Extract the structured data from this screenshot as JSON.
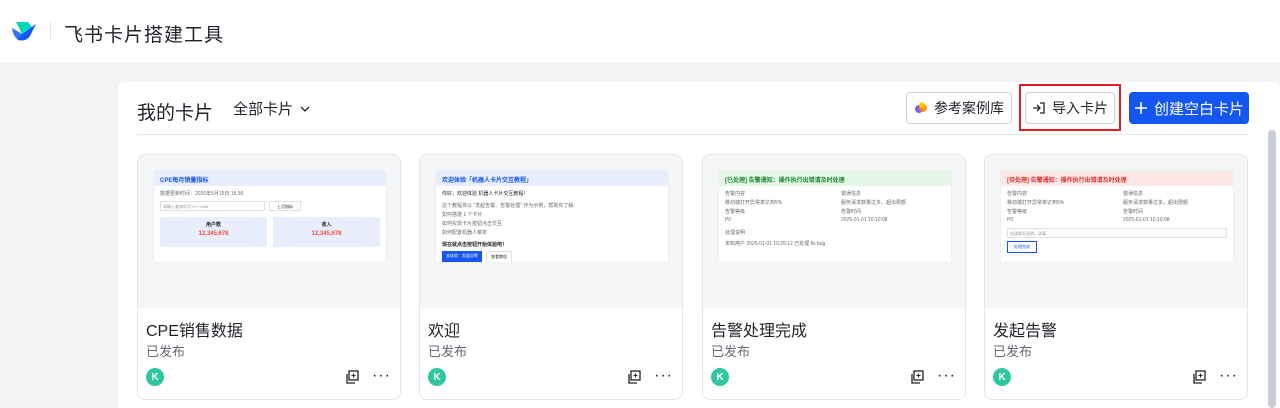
{
  "app": {
    "title": "飞书卡片搭建工具"
  },
  "panel": {
    "title": "我的卡片",
    "filter_label": "全部卡片",
    "buttons": {
      "library": "参考案例库",
      "import": "导入卡片",
      "create": "创建空白卡片"
    }
  },
  "cards": [
    {
      "name": "CPE销售数据",
      "status": "已发布",
      "owner_initial": "K",
      "preview": {
        "header": "CPE每月销量指标",
        "update": "数据更新时间：2020年5月15日 16:36",
        "input_placeholder": "请输入查询年月YYYYMM",
        "button": "上月指标",
        "metrics": [
          {
            "label": "用户数",
            "value": "12,345,678"
          },
          {
            "label": "收入",
            "value": "12,345,678"
          }
        ]
      }
    },
    {
      "name": "欢迎",
      "status": "已发布",
      "owner_initial": "K",
      "preview": {
        "header": "欢迎体验「机器人卡片交互教程」",
        "greeting": "你好，欢迎体验 机器人卡片交互教程！",
        "intro": "这个教程将以 \"发起告警、告警处理\" 作为示例，帮助你了解：",
        "bullets": [
          "如何搭建 1 个卡片",
          "如何实现卡片按钮点击交互",
          "如何配置机器人菜单"
        ],
        "cta_text": "现在就点击按钮开始体验吧！",
        "primary_button": "去体验：发起告警",
        "secondary_button": "查看教程"
      }
    },
    {
      "name": "告警处理完成",
      "status": "已发布",
      "owner_initial": "K",
      "preview": {
        "header": "[已处理] 告警通知：操作执行出错请及时处理",
        "fields": [
          {
            "label": "告警内容",
            "value": "移动端打开异常率达到5%"
          },
          {
            "label": "错误信息",
            "value": "服务请求数量过多，超出限额"
          },
          {
            "label": "告警等级",
            "value": "P0"
          },
          {
            "label": "告警时间",
            "value": "2025-01-01 10:10:08"
          }
        ],
        "section_label": "处理说明",
        "log": "未知用户  2025-01-01 10:25:12  已处理  fix bug"
      }
    },
    {
      "name": "发起告警",
      "status": "已发布",
      "owner_initial": "K",
      "preview": {
        "header": "[待处理] 告警通知：操作执行出错请及时处理",
        "fields": [
          {
            "label": "告警内容",
            "value": "移动端打开异常率达到5%"
          },
          {
            "label": "错误信息",
            "value": "服务请求数量过多，超出限额"
          },
          {
            "label": "告警等级",
            "value": "P0"
          },
          {
            "label": "告警时间",
            "value": "2025-01-01 10:10:08"
          }
        ],
        "input_placeholder": "处理情况说明，选填",
        "button": "处理完成"
      }
    }
  ],
  "colors": {
    "primary": "#1456f0",
    "highlight_border": "#e02020",
    "avatar": "#2ec7a0"
  }
}
